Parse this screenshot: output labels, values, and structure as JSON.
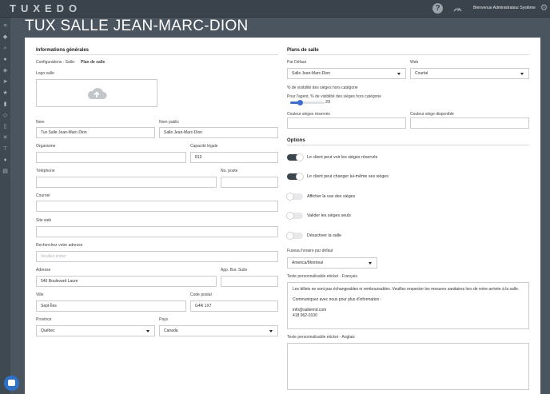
{
  "app": {
    "logo": "TUXEDO",
    "welcome": "Bienvenue Administrateur Système"
  },
  "icons": {
    "help": "help-icon",
    "gauge": "gauge-icon",
    "gear": "gear-icon",
    "upload": "cloud-upload-icon",
    "chat": "chat-icon"
  },
  "page_title": "TUX SALLE JEAN-MARC-DION",
  "general": {
    "title": "Informations générales",
    "breadcrumb_prefix": "Configurations - Salle:",
    "breadcrumb_current": "Plan de salle",
    "logo_label": "Logo salle",
    "nom_label": "Nom",
    "nom_value": "Tux Salle Jean-Marc-Dion",
    "nom_public_label": "Nom public",
    "nom_public_value": "Salle Jean-Marc-Dion",
    "organisme_label": "Organisme",
    "organisme_value": "",
    "capacite_label": "Capacité légale",
    "capacite_value": "813",
    "telephone_label": "Téléphone",
    "telephone_value": "",
    "poste_label": "No. poste",
    "poste_value": "",
    "courriel_label": "Courriel",
    "courriel_value": "",
    "site_label": "Site web",
    "site_value": "",
    "recherche_label": "Recherchez votre adresse",
    "recherche_placeholder": "Veuillez entrer",
    "adresse_label": "Adresse",
    "adresse_value": "546 Boulevard Laure",
    "app_label": "App. Bur. Suite",
    "app_value": "",
    "ville_label": "Ville",
    "ville_value": "Sept-Îles",
    "postal_label": "Code postal",
    "postal_value": "G4R 1X7",
    "province_label": "Province",
    "province_value": "Québec",
    "pays_label": "Pays",
    "pays_value": "Canada"
  },
  "plans": {
    "title": "Plans de salle",
    "defaut_label": "Par Défaut",
    "defaut_value": "Salle Jean-Marc-Dion",
    "web_label": "Web",
    "web_value": "Courbé",
    "visibility_label": "% de visibilité des sièges hors catégorie",
    "agent_label": "Pour l'agent, % de visibilité des sièges hors catégorie",
    "agent_value": "29",
    "couleur_reserves_label": "Couleur sièges réservés",
    "couleur_dispo_label": "Couleur siège disponible"
  },
  "options": {
    "title": "Options",
    "items": [
      {
        "label": "Le client peut voir les sièges réservés",
        "on": true
      },
      {
        "label": "Le client peut changer lui-même ses sièges",
        "on": true
      },
      {
        "label": "Afficher la vue des sièges",
        "on": false
      },
      {
        "label": "Valider les sièges seuls",
        "on": false
      },
      {
        "label": "Désactiver la salle",
        "on": false
      }
    ],
    "fuseau_label": "Fuseau horaire par défaut",
    "fuseau_value": "America/Montreal",
    "fr_label": "Texte personnalisable eticket - Français",
    "fr_lines": [
      "Les billets ne sont pas échangeables ni remboursables. Veuillez respecter les mesures sanitaires lors de votre arrivée à la salle.",
      "Communiquez avec nous pour plus d'information :",
      "info@salleimd.com",
      "418 962-0100"
    ],
    "en_label": "Texte personnalisable eticket - Anglais"
  }
}
